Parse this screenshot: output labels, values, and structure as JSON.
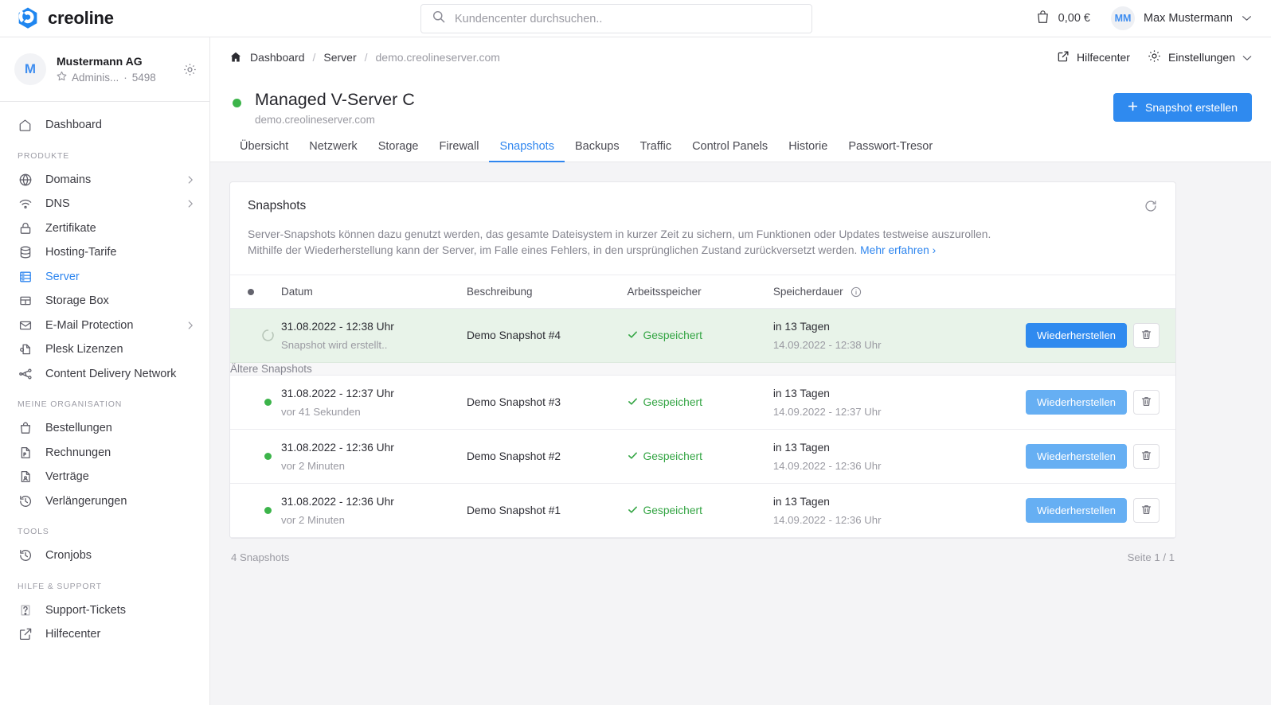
{
  "brand": {
    "name": "creoline",
    "logo_color": "#1f86f0"
  },
  "search": {
    "placeholder": "Kundencenter durchsuchen..",
    "value": ""
  },
  "topbar": {
    "cart_amount": "0,00 €",
    "user_initials": "MM",
    "user_name": "Max Mustermann"
  },
  "org": {
    "avatar_letter": "M",
    "name": "Mustermann AG",
    "role": "Adminis...",
    "separator": "·",
    "number": "5498"
  },
  "sidebar": {
    "dashboard_label": "Dashboard",
    "sections": [
      {
        "title": "PRODUKTE",
        "items": [
          {
            "label": "Domains",
            "icon": "globe-icon",
            "chevron": true,
            "active": false
          },
          {
            "label": "DNS",
            "icon": "wifi-icon",
            "chevron": true,
            "active": false
          },
          {
            "label": "Zertifikate",
            "icon": "lock-icon",
            "chevron": false,
            "active": false
          },
          {
            "label": "Hosting-Tarife",
            "icon": "database-icon",
            "chevron": false,
            "active": false
          },
          {
            "label": "Server",
            "icon": "server-icon",
            "chevron": false,
            "active": true
          },
          {
            "label": "Storage Box",
            "icon": "box-icon",
            "chevron": false,
            "active": false
          },
          {
            "label": "E-Mail Protection",
            "icon": "mail-icon",
            "chevron": true,
            "active": false
          },
          {
            "label": "Plesk Lizenzen",
            "icon": "plesk-icon",
            "chevron": false,
            "active": false
          },
          {
            "label": "Content Delivery Network",
            "icon": "network-icon",
            "chevron": false,
            "active": false
          }
        ]
      },
      {
        "title": "MEINE ORGANISATION",
        "items": [
          {
            "label": "Bestellungen",
            "icon": "bag-icon",
            "chevron": false,
            "active": false
          },
          {
            "label": "Rechnungen",
            "icon": "pdf-icon",
            "chevron": false,
            "active": false
          },
          {
            "label": "Verträge",
            "icon": "contract-icon",
            "chevron": false,
            "active": false
          },
          {
            "label": "Verlängerungen",
            "icon": "history-icon",
            "chevron": false,
            "active": false
          }
        ]
      },
      {
        "title": "TOOLS",
        "items": [
          {
            "label": "Cronjobs",
            "icon": "history-icon",
            "chevron": false,
            "active": false
          }
        ]
      },
      {
        "title": "HILFE & SUPPORT",
        "items": [
          {
            "label": "Support-Tickets",
            "icon": "ticket-icon",
            "chevron": false,
            "active": false
          },
          {
            "label": "Hilfecenter",
            "icon": "external-link-icon",
            "chevron": false,
            "active": false
          }
        ]
      }
    ]
  },
  "breadcrumb": {
    "home_icon": "home-icon",
    "items": [
      {
        "label": "Dashboard",
        "current": false
      },
      {
        "label": "Server",
        "current": false
      },
      {
        "label": "demo.creolineserver.com",
        "current": true
      }
    ],
    "separator": "/",
    "help_label": "Hilfecenter",
    "settings_label": "Einstellungen"
  },
  "page": {
    "status_color": "#3cb44a",
    "title": "Managed V-Server C",
    "subtitle": "demo.creolineserver.com",
    "primary_button": "Snapshot erstellen",
    "primary_button_icon": "plus-icon"
  },
  "tabs": [
    {
      "label": "Übersicht",
      "active": false
    },
    {
      "label": "Netzwerk",
      "active": false
    },
    {
      "label": "Storage",
      "active": false
    },
    {
      "label": "Firewall",
      "active": false
    },
    {
      "label": "Snapshots",
      "active": true
    },
    {
      "label": "Backups",
      "active": false
    },
    {
      "label": "Traffic",
      "active": false
    },
    {
      "label": "Control Panels",
      "active": false
    },
    {
      "label": "Historie",
      "active": false
    },
    {
      "label": "Passwort-Tresor",
      "active": false
    }
  ],
  "card": {
    "title": "Snapshots",
    "refresh_icon": "refresh-icon",
    "description_line1": "Server-Snapshots können dazu genutzt werden, das gesamte Dateisystem in kurzer Zeit zu sichern, um Funktionen oder Updates testweise auszurollen.",
    "description_line2": "Mithilfe der Wiederherstellung kann der Server, im Falle eines Fehlers, in den ursprünglichen Zustand zurückversetzt werden.",
    "learn_more": "Mehr erfahren ›"
  },
  "table": {
    "headers": {
      "status": "",
      "date": "Datum",
      "description": "Beschreibung",
      "memory": "Arbeitsspeicher",
      "duration": "Speicherdauer"
    },
    "group_label": "Ältere Snapshots",
    "restore_label": "Wiederherstellen",
    "delete_icon": "trash-icon",
    "rows": [
      {
        "status": "loading",
        "date": "31.08.2022 - 12:38 Uhr",
        "date_sub": "Snapshot wird erstellt..",
        "description": "Demo Snapshot #4",
        "memory": "Gespeichert",
        "duration": "in 13 Tagen",
        "duration_sub": "14.09.2022 - 12:38 Uhr",
        "current": true
      },
      {
        "status": "ok",
        "date": "31.08.2022 - 12:37 Uhr",
        "date_sub": "vor 41 Sekunden",
        "description": "Demo Snapshot #3",
        "memory": "Gespeichert",
        "duration": "in 13 Tagen",
        "duration_sub": "14.09.2022 - 12:37 Uhr",
        "current": false
      },
      {
        "status": "ok",
        "date": "31.08.2022 - 12:36 Uhr",
        "date_sub": "vor 2 Minuten",
        "description": "Demo Snapshot #2",
        "memory": "Gespeichert",
        "duration": "in 13 Tagen",
        "duration_sub": "14.09.2022 - 12:36 Uhr",
        "current": false
      },
      {
        "status": "ok",
        "date": "31.08.2022 - 12:36 Uhr",
        "date_sub": "vor 2 Minuten",
        "description": "Demo Snapshot #1",
        "memory": "Gespeichert",
        "duration": "in 13 Tagen",
        "duration_sub": "14.09.2022 - 12:36 Uhr",
        "current": false
      }
    ]
  },
  "footer": {
    "count": "4 Snapshots",
    "pagination": "Seite 1 / 1"
  },
  "colors": {
    "accent": "#2f8aef",
    "success": "#34a544",
    "row_highlight": "#e8f3e9",
    "page_bg": "#f4f4f6"
  }
}
